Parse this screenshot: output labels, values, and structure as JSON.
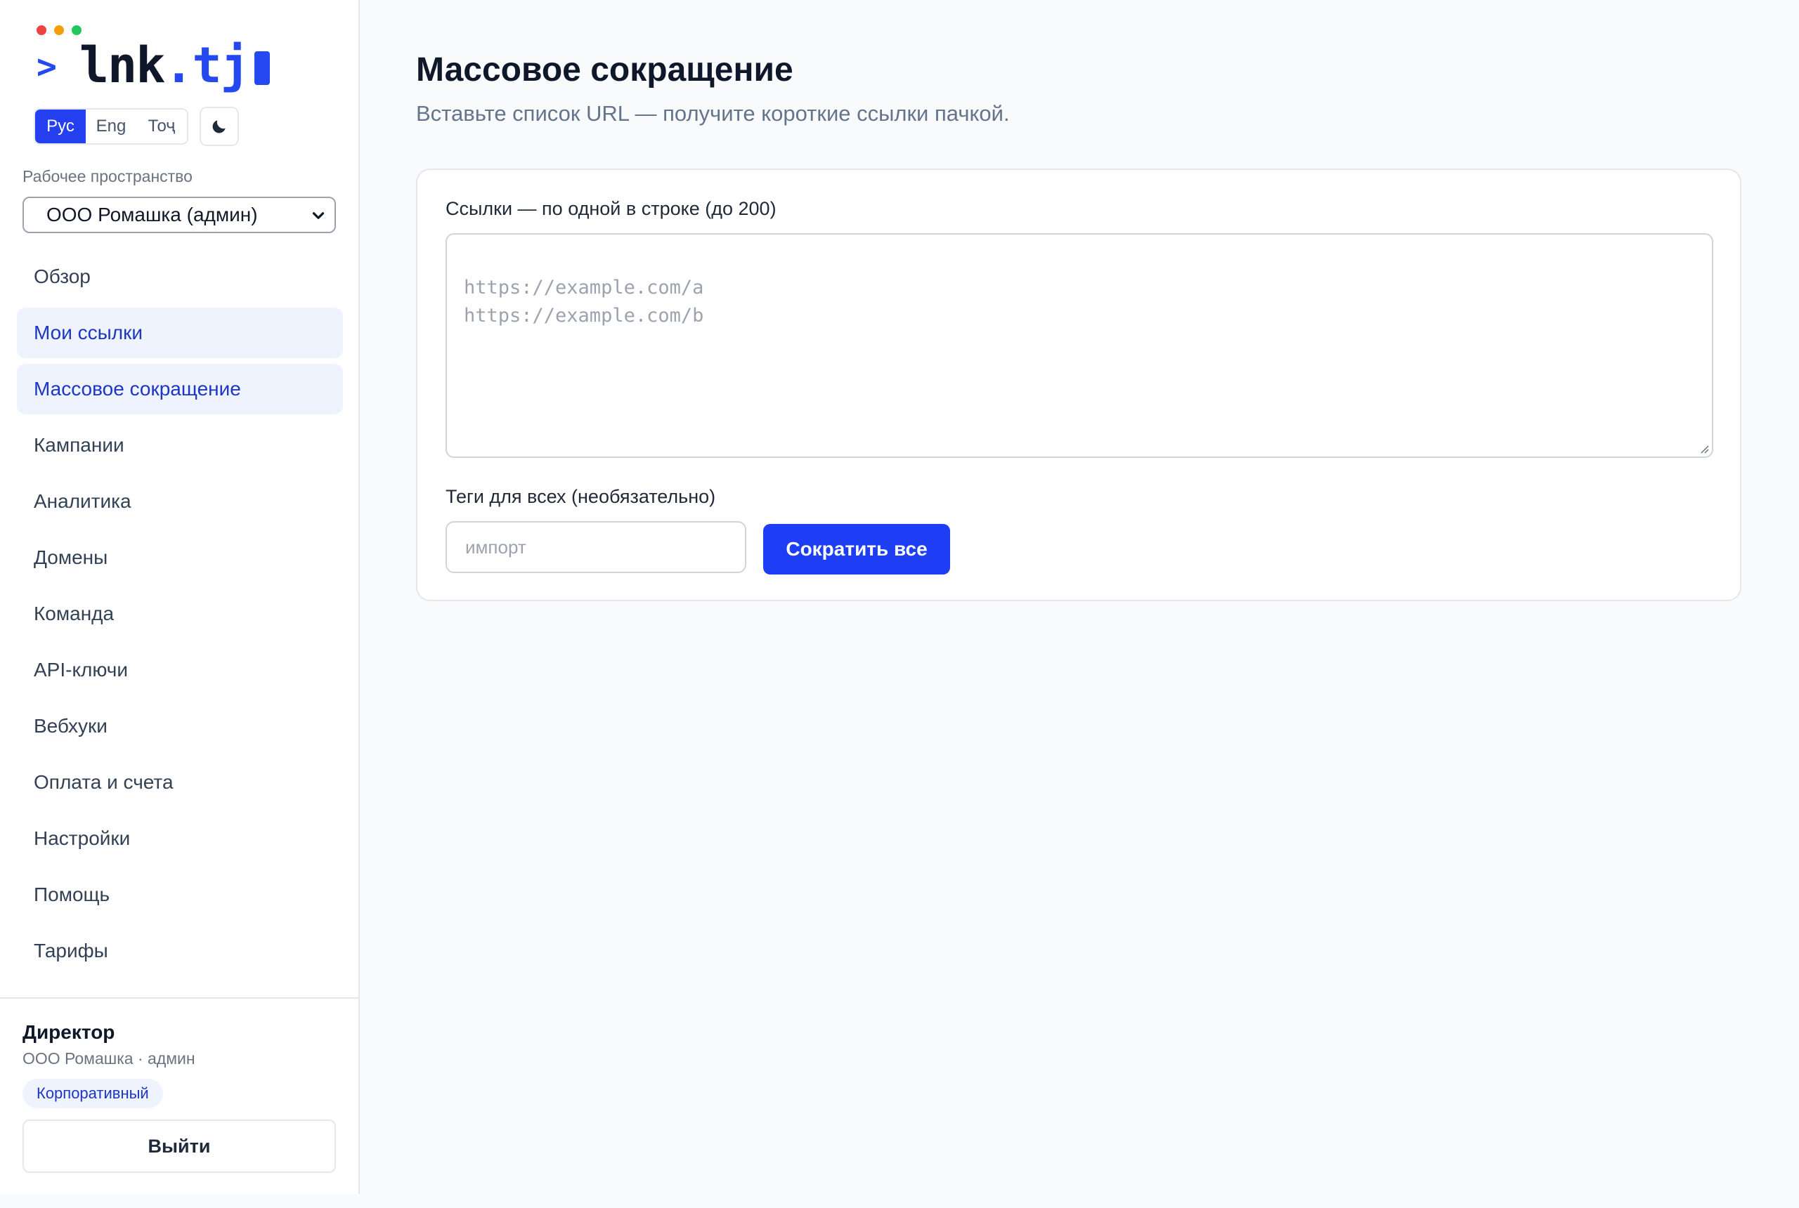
{
  "window_dots": [
    {
      "name": "close",
      "color": "#ef4444"
    },
    {
      "name": "minimize",
      "color": "#f59e0b"
    },
    {
      "name": "maximize",
      "color": "#22c55e"
    }
  ],
  "logo": {
    "prompt": ">",
    "name": "lnk",
    "tld": ".tj"
  },
  "language_switcher": {
    "options": [
      "Рус",
      "Eng",
      "Тоҷ"
    ],
    "selected": "Рус"
  },
  "theme_toggle": {
    "icon": "moon-icon"
  },
  "workspace": {
    "label": "Рабочее пространство",
    "selected": "ООО Ромашка (админ)"
  },
  "nav": {
    "items": [
      {
        "label": "Обзор",
        "highlighted": false
      },
      {
        "label": "Мои ссылки",
        "highlighted": true
      },
      {
        "label": "Массовое сокращение",
        "highlighted": true,
        "active": true
      },
      {
        "label": "Кампании",
        "highlighted": false
      },
      {
        "label": "Аналитика",
        "highlighted": false
      },
      {
        "label": "Домены",
        "highlighted": false
      },
      {
        "label": "Команда",
        "highlighted": false
      },
      {
        "label": "API-ключи",
        "highlighted": false
      },
      {
        "label": "Вебхуки",
        "highlighted": false
      },
      {
        "label": "Оплата и счета",
        "highlighted": false
      },
      {
        "label": "Настройки",
        "highlighted": false
      },
      {
        "label": "Помощь",
        "highlighted": false
      },
      {
        "label": "Тарифы",
        "highlighted": false
      }
    ]
  },
  "user": {
    "name": "Директор",
    "org": "ООО Ромашка · админ",
    "plan": "Корпоративный",
    "logout_label": "Выйти"
  },
  "page": {
    "title": "Массовое сокращение",
    "subtitle": "Вставьте список URL — получите короткие ссылки пачкой."
  },
  "form": {
    "urls_label": "Ссылки — по одной в строке (до 200)",
    "urls_placeholder": "https://example.com/a\nhttps://example.com/b",
    "urls_value": "",
    "tags_label": "Теги для всех (необязательно)",
    "tags_placeholder": "импорт",
    "tags_value": "",
    "submit_label": "Сократить все"
  },
  "colors": {
    "accent": "#2449f0",
    "nav_highlight_bg": "#eef3fd",
    "nav_highlight_text": "#1d36c6",
    "page_bg": "#f8fafc"
  }
}
